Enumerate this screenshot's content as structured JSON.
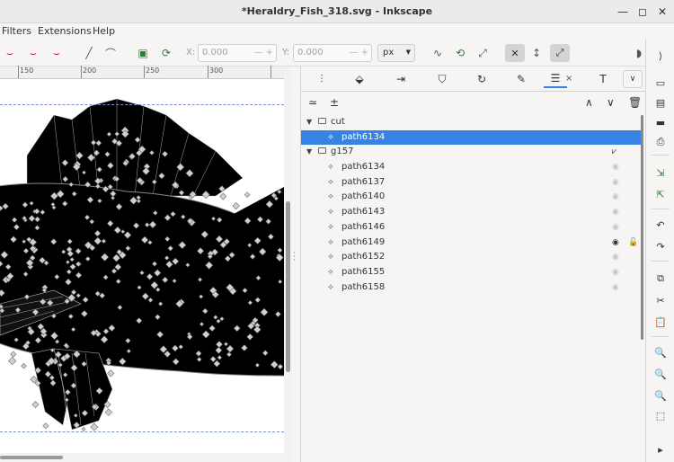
{
  "window": {
    "title": "*Heraldry_Fish_318.svg - Inkscape",
    "minimize": "—",
    "maximize": "◻",
    "close": "✕"
  },
  "menu": {
    "items": [
      "Filters",
      "Extensions",
      "Help"
    ]
  },
  "toolbar": {
    "x_label": "X:",
    "x_value": "0.000",
    "y_label": "Y:",
    "y_value": "0.000",
    "unit": "px",
    "pm": "—  +"
  },
  "ruler": {
    "ticks": [
      "150",
      "200",
      "250",
      "300"
    ]
  },
  "dock": {
    "tab_close": "×",
    "tab_more": "∨"
  },
  "layers": {
    "rows": [
      {
        "label": "cut",
        "kind": "layer",
        "expander": "▼"
      },
      {
        "label": "path6134",
        "kind": "path",
        "selected": true
      },
      {
        "label": "g157",
        "kind": "layer",
        "expander": "▼"
      },
      {
        "label": "path6134",
        "kind": "path"
      },
      {
        "label": "path6137",
        "kind": "path"
      },
      {
        "label": "path6140",
        "kind": "path"
      },
      {
        "label": "path6143",
        "kind": "path"
      },
      {
        "label": "path6146",
        "kind": "path"
      },
      {
        "label": "path6149",
        "kind": "path",
        "eye_visible": true,
        "locked": true
      },
      {
        "label": "path6152",
        "kind": "path"
      },
      {
        "label": "path6155",
        "kind": "path"
      },
      {
        "label": "path6158",
        "kind": "path"
      }
    ]
  },
  "colors": {
    "accent": "#3584e4",
    "fish": "#000000",
    "node": "#cccccc"
  }
}
